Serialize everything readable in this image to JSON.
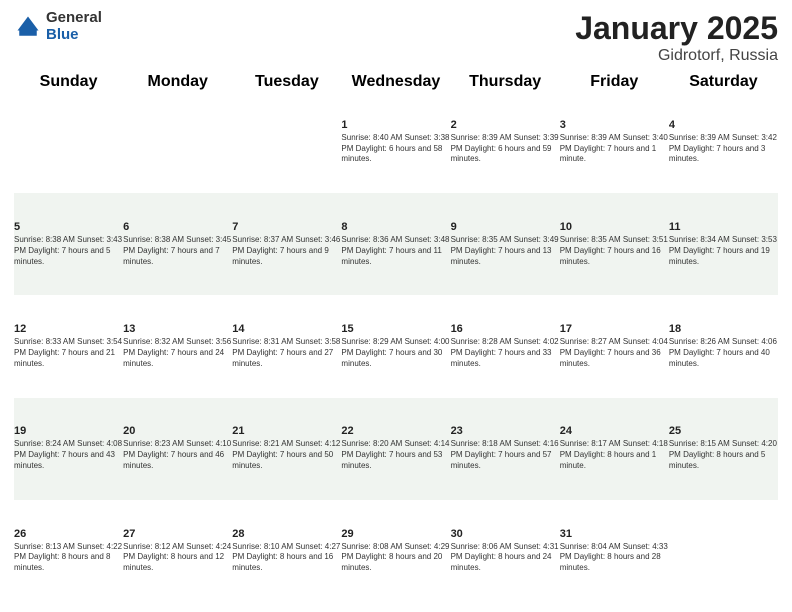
{
  "logo": {
    "general": "General",
    "blue": "Blue"
  },
  "title": "January 2025",
  "subtitle": "Gidrotorf, Russia",
  "weekdays": [
    "Sunday",
    "Monday",
    "Tuesday",
    "Wednesday",
    "Thursday",
    "Friday",
    "Saturday"
  ],
  "weeks": [
    [
      {
        "day": "",
        "info": ""
      },
      {
        "day": "",
        "info": ""
      },
      {
        "day": "",
        "info": ""
      },
      {
        "day": "1",
        "info": "Sunrise: 8:40 AM\nSunset: 3:38 PM\nDaylight: 6 hours\nand 58 minutes."
      },
      {
        "day": "2",
        "info": "Sunrise: 8:39 AM\nSunset: 3:39 PM\nDaylight: 6 hours\nand 59 minutes."
      },
      {
        "day": "3",
        "info": "Sunrise: 8:39 AM\nSunset: 3:40 PM\nDaylight: 7 hours\nand 1 minute."
      },
      {
        "day": "4",
        "info": "Sunrise: 8:39 AM\nSunset: 3:42 PM\nDaylight: 7 hours\nand 3 minutes."
      }
    ],
    [
      {
        "day": "5",
        "info": "Sunrise: 8:38 AM\nSunset: 3:43 PM\nDaylight: 7 hours\nand 5 minutes."
      },
      {
        "day": "6",
        "info": "Sunrise: 8:38 AM\nSunset: 3:45 PM\nDaylight: 7 hours\nand 7 minutes."
      },
      {
        "day": "7",
        "info": "Sunrise: 8:37 AM\nSunset: 3:46 PM\nDaylight: 7 hours\nand 9 minutes."
      },
      {
        "day": "8",
        "info": "Sunrise: 8:36 AM\nSunset: 3:48 PM\nDaylight: 7 hours\nand 11 minutes."
      },
      {
        "day": "9",
        "info": "Sunrise: 8:35 AM\nSunset: 3:49 PM\nDaylight: 7 hours\nand 13 minutes."
      },
      {
        "day": "10",
        "info": "Sunrise: 8:35 AM\nSunset: 3:51 PM\nDaylight: 7 hours\nand 16 minutes."
      },
      {
        "day": "11",
        "info": "Sunrise: 8:34 AM\nSunset: 3:53 PM\nDaylight: 7 hours\nand 19 minutes."
      }
    ],
    [
      {
        "day": "12",
        "info": "Sunrise: 8:33 AM\nSunset: 3:54 PM\nDaylight: 7 hours\nand 21 minutes."
      },
      {
        "day": "13",
        "info": "Sunrise: 8:32 AM\nSunset: 3:56 PM\nDaylight: 7 hours\nand 24 minutes."
      },
      {
        "day": "14",
        "info": "Sunrise: 8:31 AM\nSunset: 3:58 PM\nDaylight: 7 hours\nand 27 minutes."
      },
      {
        "day": "15",
        "info": "Sunrise: 8:29 AM\nSunset: 4:00 PM\nDaylight: 7 hours\nand 30 minutes."
      },
      {
        "day": "16",
        "info": "Sunrise: 8:28 AM\nSunset: 4:02 PM\nDaylight: 7 hours\nand 33 minutes."
      },
      {
        "day": "17",
        "info": "Sunrise: 8:27 AM\nSunset: 4:04 PM\nDaylight: 7 hours\nand 36 minutes."
      },
      {
        "day": "18",
        "info": "Sunrise: 8:26 AM\nSunset: 4:06 PM\nDaylight: 7 hours\nand 40 minutes."
      }
    ],
    [
      {
        "day": "19",
        "info": "Sunrise: 8:24 AM\nSunset: 4:08 PM\nDaylight: 7 hours\nand 43 minutes."
      },
      {
        "day": "20",
        "info": "Sunrise: 8:23 AM\nSunset: 4:10 PM\nDaylight: 7 hours\nand 46 minutes."
      },
      {
        "day": "21",
        "info": "Sunrise: 8:21 AM\nSunset: 4:12 PM\nDaylight: 7 hours\nand 50 minutes."
      },
      {
        "day": "22",
        "info": "Sunrise: 8:20 AM\nSunset: 4:14 PM\nDaylight: 7 hours\nand 53 minutes."
      },
      {
        "day": "23",
        "info": "Sunrise: 8:18 AM\nSunset: 4:16 PM\nDaylight: 7 hours\nand 57 minutes."
      },
      {
        "day": "24",
        "info": "Sunrise: 8:17 AM\nSunset: 4:18 PM\nDaylight: 8 hours\nand 1 minute."
      },
      {
        "day": "25",
        "info": "Sunrise: 8:15 AM\nSunset: 4:20 PM\nDaylight: 8 hours\nand 5 minutes."
      }
    ],
    [
      {
        "day": "26",
        "info": "Sunrise: 8:13 AM\nSunset: 4:22 PM\nDaylight: 8 hours\nand 8 minutes."
      },
      {
        "day": "27",
        "info": "Sunrise: 8:12 AM\nSunset: 4:24 PM\nDaylight: 8 hours\nand 12 minutes."
      },
      {
        "day": "28",
        "info": "Sunrise: 8:10 AM\nSunset: 4:27 PM\nDaylight: 8 hours\nand 16 minutes."
      },
      {
        "day": "29",
        "info": "Sunrise: 8:08 AM\nSunset: 4:29 PM\nDaylight: 8 hours\nand 20 minutes."
      },
      {
        "day": "30",
        "info": "Sunrise: 8:06 AM\nSunset: 4:31 PM\nDaylight: 8 hours\nand 24 minutes."
      },
      {
        "day": "31",
        "info": "Sunrise: 8:04 AM\nSunset: 4:33 PM\nDaylight: 8 hours\nand 28 minutes."
      },
      {
        "day": "",
        "info": ""
      }
    ]
  ]
}
